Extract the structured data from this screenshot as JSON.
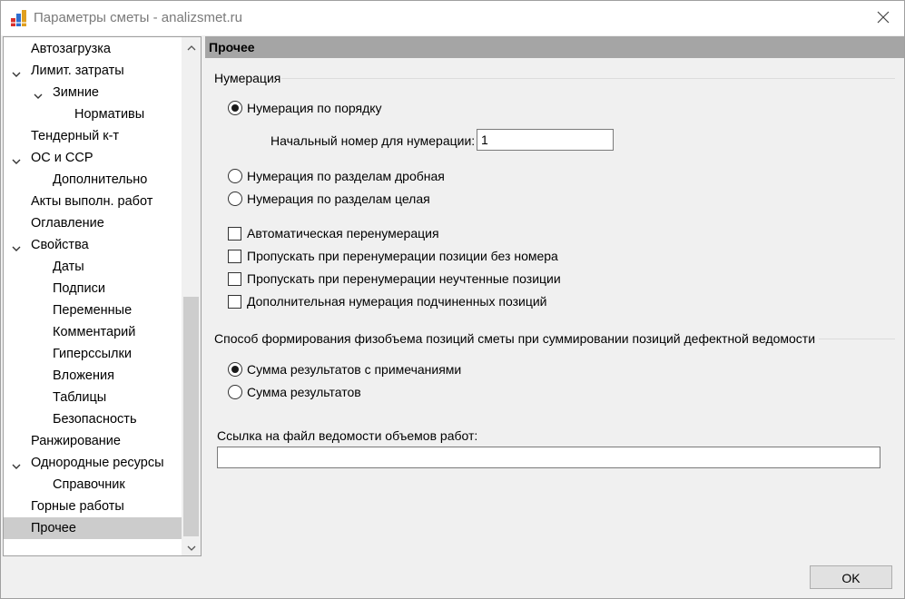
{
  "window": {
    "title": "Параметры сметы - analizsmet.ru",
    "ok_label": "OK"
  },
  "tree": {
    "items": [
      {
        "label": "Автозагрузка",
        "level": 1,
        "expanded": null,
        "selected": false
      },
      {
        "label": "Лимит. затраты",
        "level": 1,
        "expanded": true,
        "selected": false
      },
      {
        "label": "Зимние",
        "level": 2,
        "expanded": true,
        "selected": false
      },
      {
        "label": "Нормативы",
        "level": 3,
        "expanded": null,
        "selected": false
      },
      {
        "label": "Тендерный к-т",
        "level": 1,
        "expanded": null,
        "selected": false
      },
      {
        "label": "ОС и ССР",
        "level": 1,
        "expanded": true,
        "selected": false
      },
      {
        "label": "Дополнительно",
        "level": 2,
        "expanded": null,
        "selected": false
      },
      {
        "label": "Акты выполн. работ",
        "level": 1,
        "expanded": null,
        "selected": false
      },
      {
        "label": "Оглавление",
        "level": 1,
        "expanded": null,
        "selected": false
      },
      {
        "label": "Свойства",
        "level": 1,
        "expanded": true,
        "selected": false
      },
      {
        "label": "Даты",
        "level": 2,
        "expanded": null,
        "selected": false
      },
      {
        "label": "Подписи",
        "level": 2,
        "expanded": null,
        "selected": false
      },
      {
        "label": "Переменные",
        "level": 2,
        "expanded": null,
        "selected": false
      },
      {
        "label": "Комментарий",
        "level": 2,
        "expanded": null,
        "selected": false
      },
      {
        "label": "Гиперссылки",
        "level": 2,
        "expanded": null,
        "selected": false
      },
      {
        "label": "Вложения",
        "level": 2,
        "expanded": null,
        "selected": false
      },
      {
        "label": "Таблицы",
        "level": 2,
        "expanded": null,
        "selected": false
      },
      {
        "label": "Безопасность",
        "level": 2,
        "expanded": null,
        "selected": false
      },
      {
        "label": "Ранжирование",
        "level": 1,
        "expanded": null,
        "selected": false
      },
      {
        "label": "Однородные ресурсы",
        "level": 1,
        "expanded": true,
        "selected": false
      },
      {
        "label": "Справочник",
        "level": 2,
        "expanded": null,
        "selected": false
      },
      {
        "label": "Горные работы",
        "level": 1,
        "expanded": null,
        "selected": false
      },
      {
        "label": "Прочее",
        "level": 1,
        "expanded": null,
        "selected": true
      }
    ]
  },
  "panel": {
    "header": "Прочее",
    "numbering": {
      "group_title": "Нумерация",
      "radio_sequential": "Нумерация по порядку",
      "sequential_checked": true,
      "start_label": "Начальный номер для нумерации:",
      "start_value": "1",
      "radio_fractional": "Нумерация по разделам дробная",
      "radio_integer": "Нумерация по разделам целая",
      "check_auto": "Автоматическая перенумерация",
      "check_skip_no_number": "Пропускать при перенумерации позиции без номера",
      "check_skip_unaccounted": "Пропускать при перенумерации неучтенные позиции",
      "check_additional": "Дополнительная нумерация подчиненных позиций"
    },
    "volume": {
      "group_title": "Способ формирования физобъема позиций сметы при суммировании позиций дефектной ведомости",
      "radio_with_notes": "Сумма результатов с примечаниями",
      "radio_results": "Сумма результатов",
      "with_notes_checked": true
    },
    "link": {
      "label": "Ссылка на файл ведомости объемов работ:",
      "value": ""
    }
  }
}
